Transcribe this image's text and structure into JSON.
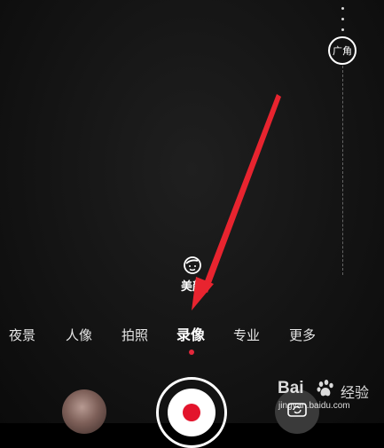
{
  "camera": {
    "wide_angle_label": "广角",
    "beauty_label": "美颜",
    "modes": [
      "夜景",
      "人像",
      "拍照",
      "录像",
      "专业",
      "更多"
    ],
    "selected_mode": "录像",
    "accent_color": "#e3142c"
  },
  "watermark": {
    "brand": "Bai",
    "brand_suffix": "经验",
    "url": "jingyan.baidu.com"
  }
}
